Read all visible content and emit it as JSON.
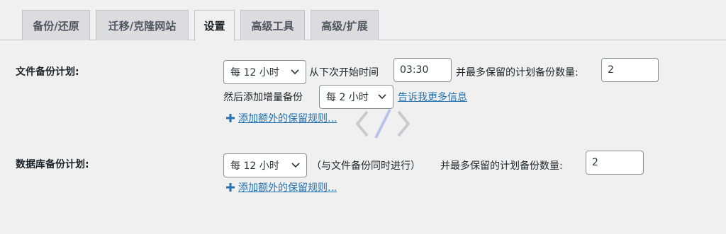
{
  "tabs": [
    {
      "label": "备份/还原"
    },
    {
      "label": "迁移/克隆网站"
    },
    {
      "label": "设置"
    },
    {
      "label": "高级工具"
    },
    {
      "label": "高级/扩展"
    }
  ],
  "file_backup": {
    "label": "文件备份计划:",
    "interval": "每 12 小时",
    "next_start_text": "从下次开始时间",
    "start_time": "03:30",
    "keep_text": "并最多保留的计划备份数量:",
    "keep_count": "2",
    "incremental_text": "然后添加增量备份",
    "incremental_interval": "每 2 小时",
    "more_info_link": "告诉我更多信息",
    "add_rule": "添加额外的保留规则..."
  },
  "db_backup": {
    "label": "数据库备份计划:",
    "interval": "每 12 小时",
    "same_time_text": "（与文件备份同时进行）",
    "keep_text": "并最多保留的计划备份数量:",
    "keep_count": "2",
    "add_rule": "添加额外的保留规则..."
  },
  "colors": {
    "link": "#2271b1",
    "background": "#f0f0f1",
    "tab_inactive": "#dcdcde"
  },
  "icons": {
    "select_arrow": "chevron-down-icon",
    "add": "plus-icon",
    "watermark": "code-brackets-icon"
  }
}
